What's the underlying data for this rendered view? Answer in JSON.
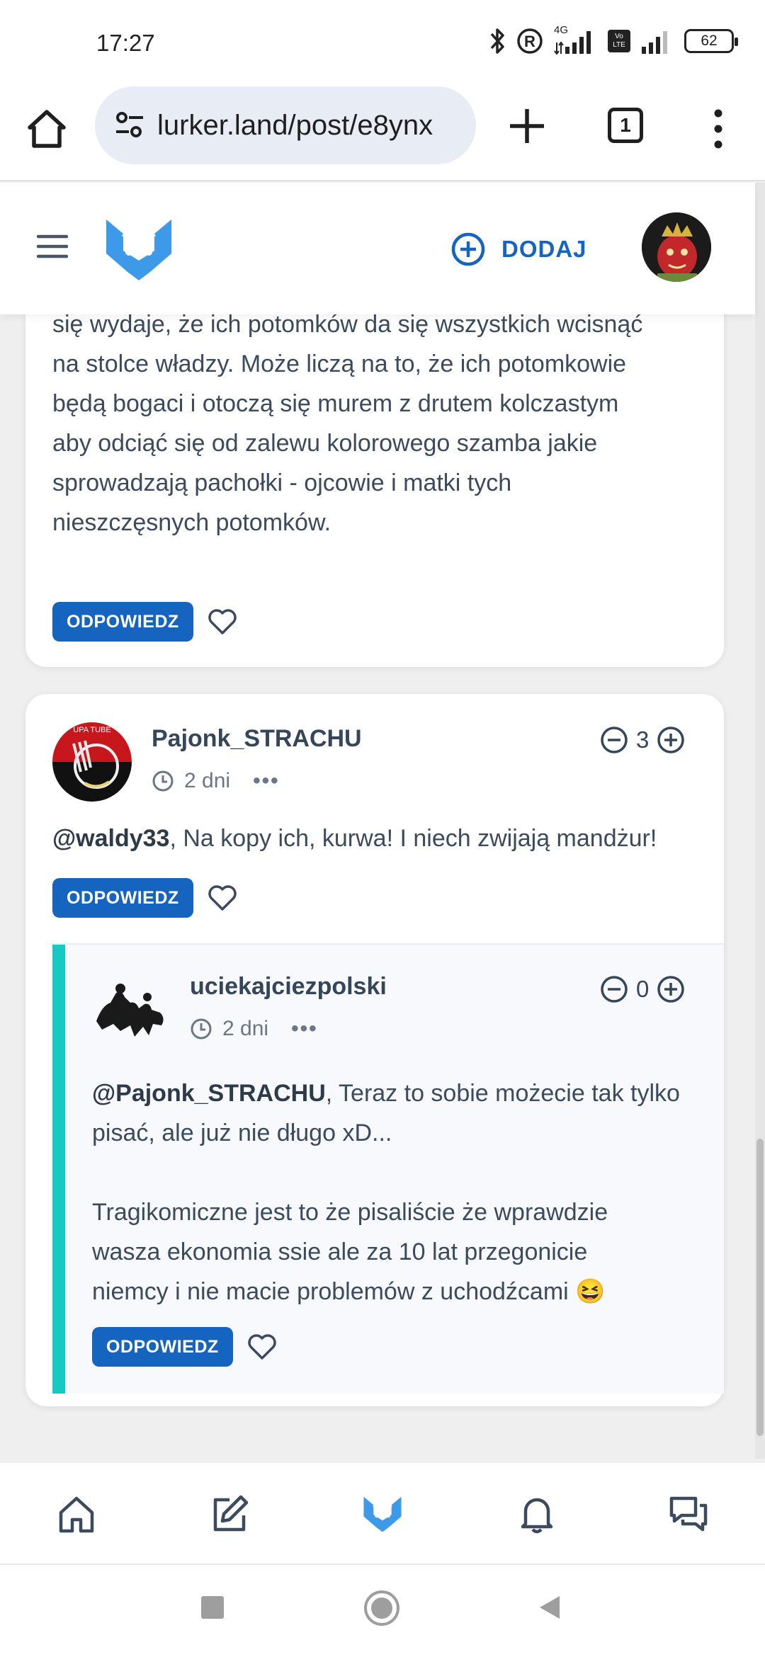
{
  "status_bar": {
    "time": "17:27",
    "network": "4G",
    "volte": "Vo LTE",
    "battery": "62"
  },
  "browser": {
    "url": "lurker.land/post/e8ynx",
    "tab_count": "1"
  },
  "header": {
    "add_label": "DODAJ"
  },
  "top_post": {
    "text": "się wydaje, że ich potomków da się wszystkich wcisnąć\nna stolce władzy. Może liczą na to, że ich potomkowie\nbędą bogaci i otoczą się murem z drutem kolczastym\naby odciąć się od zalewu kolorowego szamba jakie\nsprowadzają pachołki - ojcowie i matki tych\nnieszczęsnych potomków.",
    "reply_label": "ODPOWIEDZ"
  },
  "comment": {
    "author": "Pajonk_STRACHU",
    "time": "2 dni",
    "votes": "3",
    "mention": "@waldy33",
    "text": ", Na kopy ich, kurwa! I niech zwijają mandżur!",
    "reply_label": "ODPOWIEDZ",
    "avatar_text": "UPA TUBE"
  },
  "reply": {
    "author": "uciekajciezpolski",
    "time": "2 dni",
    "votes": "0",
    "mention": "@Pajonk_STRACHU",
    "text_line1": ", Teraz to sobie możecie tak tylko",
    "text_rest": "pisać, ale już nie długo xD...\n\nTragikomiczne jest to że pisaliście że wprawdzie\nwasza ekonomia ssie ale za 10 lat przegonicie\nniemcy i nie macie problemów z uchodźcami",
    "emoji": "😆",
    "reply_label": "ODPOWIEDZ"
  },
  "icons": {
    "nav": [
      "home-icon",
      "edit-icon",
      "lurker-logo-icon",
      "bell-icon",
      "chat-icon"
    ],
    "accent": "#1565c0",
    "thread_color": "#16c9c2",
    "logo_color": "#3d9ae8"
  }
}
